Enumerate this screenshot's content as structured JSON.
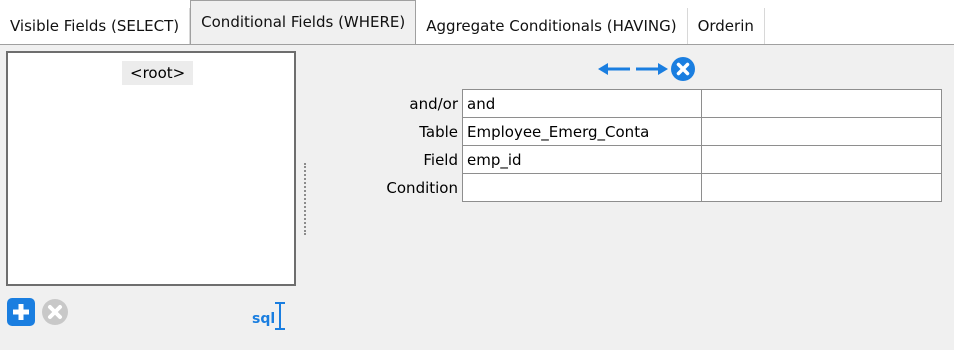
{
  "tabs": [
    {
      "label": "Visible Fields (SELECT)"
    },
    {
      "label": "Conditional Fields (WHERE)"
    },
    {
      "label": "Aggregate Conditionals (HAVING)"
    },
    {
      "label": "Orderin"
    }
  ],
  "tree": {
    "root_label": "<root>"
  },
  "form": {
    "rows": [
      {
        "label": "and/or",
        "value": "and",
        "value2": ""
      },
      {
        "label": "Table",
        "value": "Employee_Emerg_Conta",
        "value2": ""
      },
      {
        "label": "Field",
        "value": "emp_id",
        "value2": ""
      },
      {
        "label": "Condition",
        "value": "",
        "value2": ""
      }
    ]
  },
  "toolbar": {
    "sql_label": "sql"
  },
  "colors": {
    "accent": "#1a7ee0",
    "disabled": "#c8c8c8"
  },
  "icons": [
    "arrow-left-icon",
    "arrow-right-icon",
    "close-circle-icon",
    "add-icon",
    "remove-icon",
    "sql-cursor-icon"
  ]
}
